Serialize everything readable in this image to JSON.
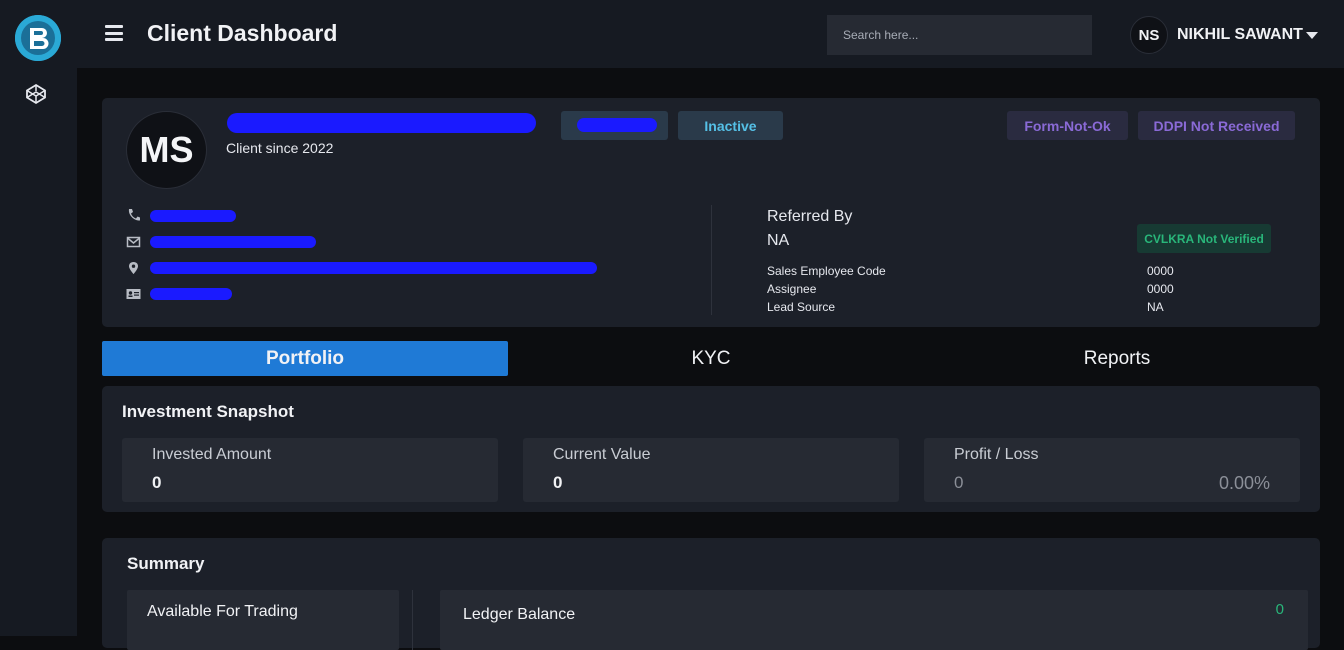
{
  "app": {
    "logo_letter": "B",
    "page_title": "Client Dashboard"
  },
  "search": {
    "placeholder": "Search here..."
  },
  "user": {
    "initials": "NS",
    "name": "NIKHIL SAWANT"
  },
  "client": {
    "initials": "MS",
    "since": "Client since 2022",
    "status": "Inactive",
    "badges": [
      "Form-Not-Ok",
      "DDPI Not Received"
    ],
    "referred_by_label": "Referred By",
    "referred_by_value": "NA",
    "cvlkra": "CVLKRA Not Verified",
    "details": [
      {
        "label": "Sales Employee Code",
        "value": "0000"
      },
      {
        "label": "Assignee",
        "value": "0000"
      },
      {
        "label": "Lead Source",
        "value": "NA"
      }
    ]
  },
  "tabs": [
    {
      "label": "Portfolio",
      "active": true
    },
    {
      "label": "KYC",
      "active": false
    },
    {
      "label": "Reports",
      "active": false
    }
  ],
  "snapshot": {
    "title": "Investment Snapshot",
    "invested_label": "Invested Amount",
    "invested_value": "0",
    "current_label": "Current Value",
    "current_value": "0",
    "pl_label": "Profit / Loss",
    "pl_value": "0",
    "pl_percent": "0.00%"
  },
  "summary": {
    "title": "Summary",
    "available_label": "Available For Trading",
    "ledger_label": "Ledger Balance",
    "ledger_value": "0"
  },
  "colors": {
    "accent": "#1f7ad6",
    "positive": "#29b67a",
    "status_info": "#55c0e6",
    "status_warn": "#8a6ad6",
    "redaction": "#1a1aff"
  }
}
